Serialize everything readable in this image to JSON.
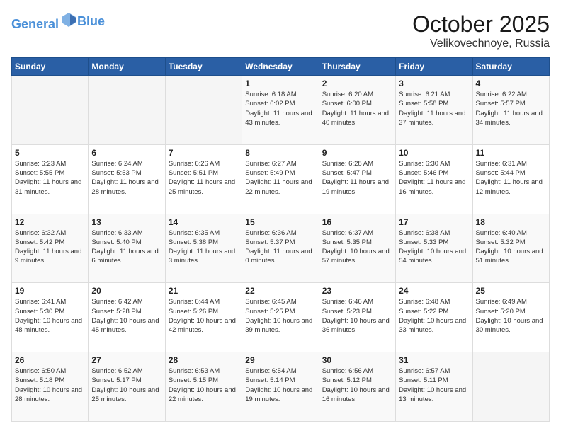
{
  "header": {
    "logo_line1": "General",
    "logo_line2": "Blue",
    "title": "October 2025",
    "subtitle": "Velikovechnoye, Russia"
  },
  "days_of_week": [
    "Sunday",
    "Monday",
    "Tuesday",
    "Wednesday",
    "Thursday",
    "Friday",
    "Saturday"
  ],
  "weeks": [
    [
      {
        "day": "",
        "info": ""
      },
      {
        "day": "",
        "info": ""
      },
      {
        "day": "",
        "info": ""
      },
      {
        "day": "1",
        "info": "Sunrise: 6:18 AM\nSunset: 6:02 PM\nDaylight: 11 hours\nand 43 minutes."
      },
      {
        "day": "2",
        "info": "Sunrise: 6:20 AM\nSunset: 6:00 PM\nDaylight: 11 hours\nand 40 minutes."
      },
      {
        "day": "3",
        "info": "Sunrise: 6:21 AM\nSunset: 5:58 PM\nDaylight: 11 hours\nand 37 minutes."
      },
      {
        "day": "4",
        "info": "Sunrise: 6:22 AM\nSunset: 5:57 PM\nDaylight: 11 hours\nand 34 minutes."
      }
    ],
    [
      {
        "day": "5",
        "info": "Sunrise: 6:23 AM\nSunset: 5:55 PM\nDaylight: 11 hours\nand 31 minutes."
      },
      {
        "day": "6",
        "info": "Sunrise: 6:24 AM\nSunset: 5:53 PM\nDaylight: 11 hours\nand 28 minutes."
      },
      {
        "day": "7",
        "info": "Sunrise: 6:26 AM\nSunset: 5:51 PM\nDaylight: 11 hours\nand 25 minutes."
      },
      {
        "day": "8",
        "info": "Sunrise: 6:27 AM\nSunset: 5:49 PM\nDaylight: 11 hours\nand 22 minutes."
      },
      {
        "day": "9",
        "info": "Sunrise: 6:28 AM\nSunset: 5:47 PM\nDaylight: 11 hours\nand 19 minutes."
      },
      {
        "day": "10",
        "info": "Sunrise: 6:30 AM\nSunset: 5:46 PM\nDaylight: 11 hours\nand 16 minutes."
      },
      {
        "day": "11",
        "info": "Sunrise: 6:31 AM\nSunset: 5:44 PM\nDaylight: 11 hours\nand 12 minutes."
      }
    ],
    [
      {
        "day": "12",
        "info": "Sunrise: 6:32 AM\nSunset: 5:42 PM\nDaylight: 11 hours\nand 9 minutes."
      },
      {
        "day": "13",
        "info": "Sunrise: 6:33 AM\nSunset: 5:40 PM\nDaylight: 11 hours\nand 6 minutes."
      },
      {
        "day": "14",
        "info": "Sunrise: 6:35 AM\nSunset: 5:38 PM\nDaylight: 11 hours\nand 3 minutes."
      },
      {
        "day": "15",
        "info": "Sunrise: 6:36 AM\nSunset: 5:37 PM\nDaylight: 11 hours\nand 0 minutes."
      },
      {
        "day": "16",
        "info": "Sunrise: 6:37 AM\nSunset: 5:35 PM\nDaylight: 10 hours\nand 57 minutes."
      },
      {
        "day": "17",
        "info": "Sunrise: 6:38 AM\nSunset: 5:33 PM\nDaylight: 10 hours\nand 54 minutes."
      },
      {
        "day": "18",
        "info": "Sunrise: 6:40 AM\nSunset: 5:32 PM\nDaylight: 10 hours\nand 51 minutes."
      }
    ],
    [
      {
        "day": "19",
        "info": "Sunrise: 6:41 AM\nSunset: 5:30 PM\nDaylight: 10 hours\nand 48 minutes."
      },
      {
        "day": "20",
        "info": "Sunrise: 6:42 AM\nSunset: 5:28 PM\nDaylight: 10 hours\nand 45 minutes."
      },
      {
        "day": "21",
        "info": "Sunrise: 6:44 AM\nSunset: 5:26 PM\nDaylight: 10 hours\nand 42 minutes."
      },
      {
        "day": "22",
        "info": "Sunrise: 6:45 AM\nSunset: 5:25 PM\nDaylight: 10 hours\nand 39 minutes."
      },
      {
        "day": "23",
        "info": "Sunrise: 6:46 AM\nSunset: 5:23 PM\nDaylight: 10 hours\nand 36 minutes."
      },
      {
        "day": "24",
        "info": "Sunrise: 6:48 AM\nSunset: 5:22 PM\nDaylight: 10 hours\nand 33 minutes."
      },
      {
        "day": "25",
        "info": "Sunrise: 6:49 AM\nSunset: 5:20 PM\nDaylight: 10 hours\nand 30 minutes."
      }
    ],
    [
      {
        "day": "26",
        "info": "Sunrise: 6:50 AM\nSunset: 5:18 PM\nDaylight: 10 hours\nand 28 minutes."
      },
      {
        "day": "27",
        "info": "Sunrise: 6:52 AM\nSunset: 5:17 PM\nDaylight: 10 hours\nand 25 minutes."
      },
      {
        "day": "28",
        "info": "Sunrise: 6:53 AM\nSunset: 5:15 PM\nDaylight: 10 hours\nand 22 minutes."
      },
      {
        "day": "29",
        "info": "Sunrise: 6:54 AM\nSunset: 5:14 PM\nDaylight: 10 hours\nand 19 minutes."
      },
      {
        "day": "30",
        "info": "Sunrise: 6:56 AM\nSunset: 5:12 PM\nDaylight: 10 hours\nand 16 minutes."
      },
      {
        "day": "31",
        "info": "Sunrise: 6:57 AM\nSunset: 5:11 PM\nDaylight: 10 hours\nand 13 minutes."
      },
      {
        "day": "",
        "info": ""
      }
    ]
  ]
}
